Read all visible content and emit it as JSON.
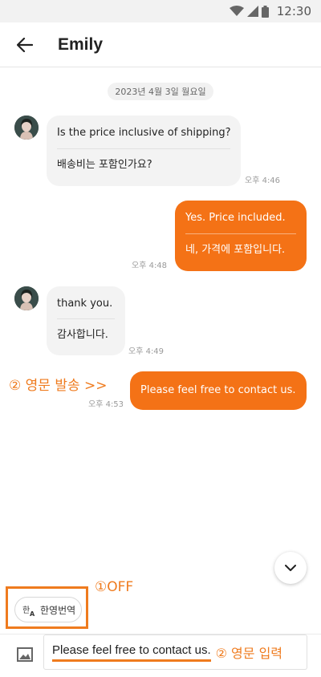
{
  "status_bar": {
    "time": "12:30"
  },
  "header": {
    "title": "Emily"
  },
  "chat": {
    "date": "2023년 4월 3일 월요일",
    "messages": [
      {
        "direction": "incoming",
        "original": "Is the price inclusive of shipping?",
        "translation": "배송비는 포함인가요?",
        "time": "오후 4:46"
      },
      {
        "direction": "outgoing",
        "original": "Yes. Price included.",
        "translation": "네, 가격에 포함입니다.",
        "time": "오후 4:48"
      },
      {
        "direction": "incoming",
        "original": "thank you.",
        "translation": "감사합니다.",
        "time": "오후 4:49"
      },
      {
        "direction": "outgoing",
        "original": "Please feel free to contact us.",
        "time": "오후 4:53"
      }
    ]
  },
  "annotations": {
    "send_english": "② 영문 발송 >>",
    "translate_off": "①OFF",
    "input_english": "② 영문 입력"
  },
  "translate_toggle": {
    "label": "한영번역"
  },
  "composer": {
    "value": "Please feel free to contact us."
  },
  "colors": {
    "accent": "#f47216",
    "annotation": "#ef7b1e",
    "incoming_bubble": "#f3f3f3"
  }
}
